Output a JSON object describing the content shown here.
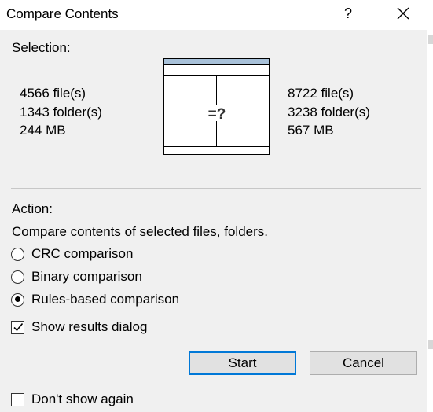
{
  "window": {
    "title": "Compare Contents",
    "help_glyph": "?",
    "close_icon": "close-icon",
    "help_icon": "help-icon"
  },
  "selection": {
    "label": "Selection:",
    "left": [
      "4566 file(s)",
      "1343 folder(s)",
      "244 MB"
    ],
    "right": [
      "8722 file(s)",
      "3238 folder(s)",
      "567 MB"
    ],
    "compare_glyph": "=?"
  },
  "action": {
    "label": "Action:",
    "description": "Compare contents of selected files, folders.",
    "options": [
      {
        "label": "CRC comparison",
        "checked": false
      },
      {
        "label": "Binary comparison",
        "checked": false
      },
      {
        "label": "Rules-based comparison",
        "checked": true
      }
    ],
    "show_results": {
      "label": "Show results dialog",
      "checked": true
    }
  },
  "buttons": {
    "start": "Start",
    "cancel": "Cancel"
  },
  "footer": {
    "dont_show": {
      "label": "Don't show again",
      "checked": false
    }
  },
  "colors": {
    "accent": "#0078d7",
    "illustration_header": "#a8c1d9"
  }
}
